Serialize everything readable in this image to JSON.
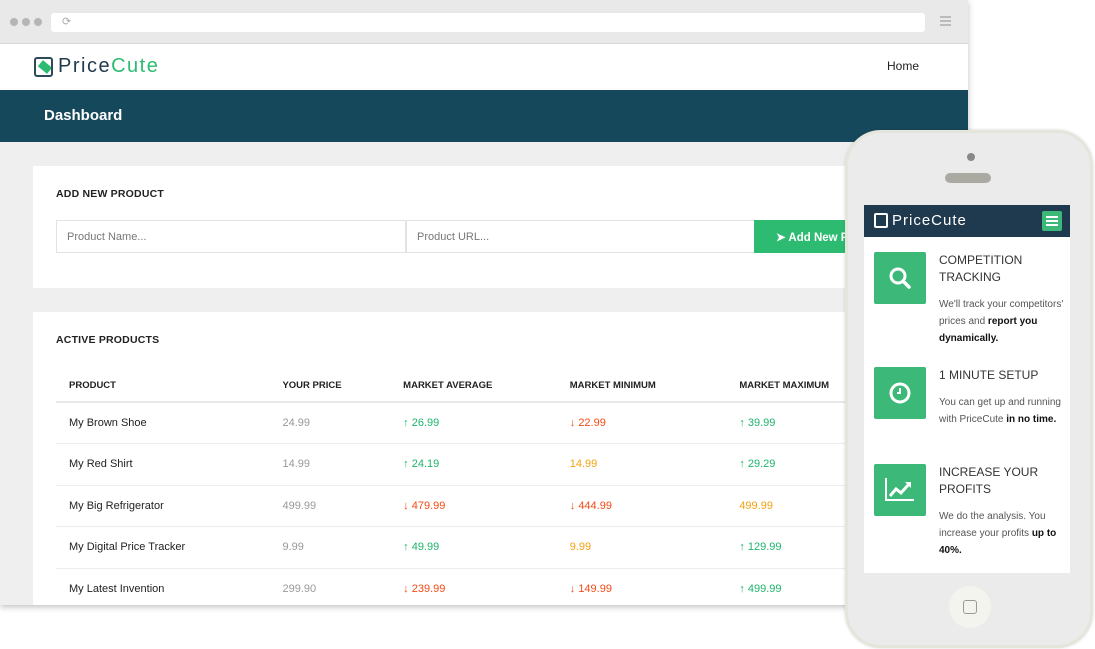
{
  "brand": {
    "part1": "Price",
    "part2": "Cute",
    "accent": "#2dbb72"
  },
  "nav": {
    "home": "Home"
  },
  "header": {
    "title": "Dashboard"
  },
  "add_product": {
    "title": "ADD NEW PRODUCT",
    "name_placeholder": "Product Name...",
    "url_placeholder": "Product URL...",
    "button": "Add New Product"
  },
  "active_products": {
    "title": "ACTIVE PRODUCTS",
    "columns": [
      "PRODUCT",
      "YOUR PRICE",
      "MARKET AVERAGE",
      "MARKET MINIMUM",
      "MARKET MAXIMUM"
    ],
    "rows": [
      {
        "product": "My Brown Shoe",
        "price": "24.99",
        "avg": "26.99",
        "avg_t": "up",
        "min": "22.99",
        "min_t": "down",
        "max": "39.99",
        "max_t": "up"
      },
      {
        "product": "My Red Shirt",
        "price": "14.99",
        "avg": "24.19",
        "avg_t": "up",
        "min": "14.99",
        "min_t": "eq",
        "max": "29.29",
        "max_t": "up"
      },
      {
        "product": "My Big Refrigerator",
        "price": "499.99",
        "avg": "479.99",
        "avg_t": "down",
        "min": "444.99",
        "min_t": "down",
        "max": "499.99",
        "max_t": "eq"
      },
      {
        "product": "My Digital Price Tracker",
        "price": "9.99",
        "avg": "49.99",
        "avg_t": "up",
        "min": "9.99",
        "min_t": "eq",
        "max": "129.99",
        "max_t": "up"
      },
      {
        "product": "My Latest Invention",
        "price": "299.90",
        "avg": "239.99",
        "avg_t": "down",
        "min": "149.99",
        "min_t": "down",
        "max": "499.99",
        "max_t": "up"
      }
    ]
  },
  "mobile": {
    "brand": "PriceCute",
    "features": [
      {
        "icon": "search-icon",
        "title": "COMPETITION TRACKING",
        "text": "We'll track your competitors' prices and ",
        "bold": "report you dynamically."
      },
      {
        "icon": "clock-icon",
        "title": "1 MINUTE SETUP",
        "text": "You can get up and running with PriceCute ",
        "bold": "in no time."
      },
      {
        "icon": "chart-icon",
        "title": "INCREASE YOUR PROFITS",
        "text": "We do the analysis. You increase your profits ",
        "bold": "up to 40%."
      }
    ]
  }
}
